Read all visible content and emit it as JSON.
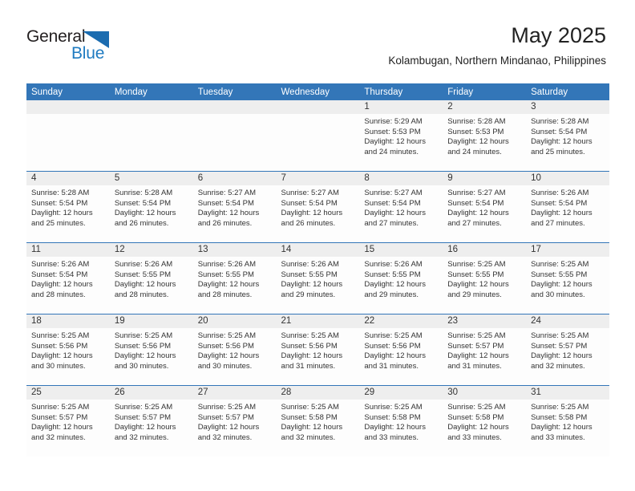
{
  "logo": {
    "line1": "General",
    "line2": "Blue",
    "triangle_color": "#1b6cb0",
    "blue_text_color": "#1f7bc1"
  },
  "header": {
    "month_title": "May 2025",
    "location": "Kolambugan, Northern Mindanao, Philippines"
  },
  "theme": {
    "header_bg": "#3376b8",
    "header_text": "#ffffff",
    "date_band_bg": "#eeeeee",
    "cell_bg": "#fdfdfd",
    "row_border": "#3376b8"
  },
  "calendar": {
    "weekday_headers": [
      "Sunday",
      "Monday",
      "Tuesday",
      "Wednesday",
      "Thursday",
      "Friday",
      "Saturday"
    ],
    "weeks": [
      [
        {
          "date": "",
          "sunrise": "",
          "sunset": "",
          "daylight_line1": "",
          "daylight_line2": ""
        },
        {
          "date": "",
          "sunrise": "",
          "sunset": "",
          "daylight_line1": "",
          "daylight_line2": ""
        },
        {
          "date": "",
          "sunrise": "",
          "sunset": "",
          "daylight_line1": "",
          "daylight_line2": ""
        },
        {
          "date": "",
          "sunrise": "",
          "sunset": "",
          "daylight_line1": "",
          "daylight_line2": ""
        },
        {
          "date": "1",
          "sunrise": "Sunrise: 5:29 AM",
          "sunset": "Sunset: 5:53 PM",
          "daylight_line1": "Daylight: 12 hours",
          "daylight_line2": "and 24 minutes."
        },
        {
          "date": "2",
          "sunrise": "Sunrise: 5:28 AM",
          "sunset": "Sunset: 5:53 PM",
          "daylight_line1": "Daylight: 12 hours",
          "daylight_line2": "and 24 minutes."
        },
        {
          "date": "3",
          "sunrise": "Sunrise: 5:28 AM",
          "sunset": "Sunset: 5:54 PM",
          "daylight_line1": "Daylight: 12 hours",
          "daylight_line2": "and 25 minutes."
        }
      ],
      [
        {
          "date": "4",
          "sunrise": "Sunrise: 5:28 AM",
          "sunset": "Sunset: 5:54 PM",
          "daylight_line1": "Daylight: 12 hours",
          "daylight_line2": "and 25 minutes."
        },
        {
          "date": "5",
          "sunrise": "Sunrise: 5:28 AM",
          "sunset": "Sunset: 5:54 PM",
          "daylight_line1": "Daylight: 12 hours",
          "daylight_line2": "and 26 minutes."
        },
        {
          "date": "6",
          "sunrise": "Sunrise: 5:27 AM",
          "sunset": "Sunset: 5:54 PM",
          "daylight_line1": "Daylight: 12 hours",
          "daylight_line2": "and 26 minutes."
        },
        {
          "date": "7",
          "sunrise": "Sunrise: 5:27 AM",
          "sunset": "Sunset: 5:54 PM",
          "daylight_line1": "Daylight: 12 hours",
          "daylight_line2": "and 26 minutes."
        },
        {
          "date": "8",
          "sunrise": "Sunrise: 5:27 AM",
          "sunset": "Sunset: 5:54 PM",
          "daylight_line1": "Daylight: 12 hours",
          "daylight_line2": "and 27 minutes."
        },
        {
          "date": "9",
          "sunrise": "Sunrise: 5:27 AM",
          "sunset": "Sunset: 5:54 PM",
          "daylight_line1": "Daylight: 12 hours",
          "daylight_line2": "and 27 minutes."
        },
        {
          "date": "10",
          "sunrise": "Sunrise: 5:26 AM",
          "sunset": "Sunset: 5:54 PM",
          "daylight_line1": "Daylight: 12 hours",
          "daylight_line2": "and 27 minutes."
        }
      ],
      [
        {
          "date": "11",
          "sunrise": "Sunrise: 5:26 AM",
          "sunset": "Sunset: 5:54 PM",
          "daylight_line1": "Daylight: 12 hours",
          "daylight_line2": "and 28 minutes."
        },
        {
          "date": "12",
          "sunrise": "Sunrise: 5:26 AM",
          "sunset": "Sunset: 5:55 PM",
          "daylight_line1": "Daylight: 12 hours",
          "daylight_line2": "and 28 minutes."
        },
        {
          "date": "13",
          "sunrise": "Sunrise: 5:26 AM",
          "sunset": "Sunset: 5:55 PM",
          "daylight_line1": "Daylight: 12 hours",
          "daylight_line2": "and 28 minutes."
        },
        {
          "date": "14",
          "sunrise": "Sunrise: 5:26 AM",
          "sunset": "Sunset: 5:55 PM",
          "daylight_line1": "Daylight: 12 hours",
          "daylight_line2": "and 29 minutes."
        },
        {
          "date": "15",
          "sunrise": "Sunrise: 5:26 AM",
          "sunset": "Sunset: 5:55 PM",
          "daylight_line1": "Daylight: 12 hours",
          "daylight_line2": "and 29 minutes."
        },
        {
          "date": "16",
          "sunrise": "Sunrise: 5:25 AM",
          "sunset": "Sunset: 5:55 PM",
          "daylight_line1": "Daylight: 12 hours",
          "daylight_line2": "and 29 minutes."
        },
        {
          "date": "17",
          "sunrise": "Sunrise: 5:25 AM",
          "sunset": "Sunset: 5:55 PM",
          "daylight_line1": "Daylight: 12 hours",
          "daylight_line2": "and 30 minutes."
        }
      ],
      [
        {
          "date": "18",
          "sunrise": "Sunrise: 5:25 AM",
          "sunset": "Sunset: 5:56 PM",
          "daylight_line1": "Daylight: 12 hours",
          "daylight_line2": "and 30 minutes."
        },
        {
          "date": "19",
          "sunrise": "Sunrise: 5:25 AM",
          "sunset": "Sunset: 5:56 PM",
          "daylight_line1": "Daylight: 12 hours",
          "daylight_line2": "and 30 minutes."
        },
        {
          "date": "20",
          "sunrise": "Sunrise: 5:25 AM",
          "sunset": "Sunset: 5:56 PM",
          "daylight_line1": "Daylight: 12 hours",
          "daylight_line2": "and 30 minutes."
        },
        {
          "date": "21",
          "sunrise": "Sunrise: 5:25 AM",
          "sunset": "Sunset: 5:56 PM",
          "daylight_line1": "Daylight: 12 hours",
          "daylight_line2": "and 31 minutes."
        },
        {
          "date": "22",
          "sunrise": "Sunrise: 5:25 AM",
          "sunset": "Sunset: 5:56 PM",
          "daylight_line1": "Daylight: 12 hours",
          "daylight_line2": "and 31 minutes."
        },
        {
          "date": "23",
          "sunrise": "Sunrise: 5:25 AM",
          "sunset": "Sunset: 5:57 PM",
          "daylight_line1": "Daylight: 12 hours",
          "daylight_line2": "and 31 minutes."
        },
        {
          "date": "24",
          "sunrise": "Sunrise: 5:25 AM",
          "sunset": "Sunset: 5:57 PM",
          "daylight_line1": "Daylight: 12 hours",
          "daylight_line2": "and 32 minutes."
        }
      ],
      [
        {
          "date": "25",
          "sunrise": "Sunrise: 5:25 AM",
          "sunset": "Sunset: 5:57 PM",
          "daylight_line1": "Daylight: 12 hours",
          "daylight_line2": "and 32 minutes."
        },
        {
          "date": "26",
          "sunrise": "Sunrise: 5:25 AM",
          "sunset": "Sunset: 5:57 PM",
          "daylight_line1": "Daylight: 12 hours",
          "daylight_line2": "and 32 minutes."
        },
        {
          "date": "27",
          "sunrise": "Sunrise: 5:25 AM",
          "sunset": "Sunset: 5:57 PM",
          "daylight_line1": "Daylight: 12 hours",
          "daylight_line2": "and 32 minutes."
        },
        {
          "date": "28",
          "sunrise": "Sunrise: 5:25 AM",
          "sunset": "Sunset: 5:58 PM",
          "daylight_line1": "Daylight: 12 hours",
          "daylight_line2": "and 32 minutes."
        },
        {
          "date": "29",
          "sunrise": "Sunrise: 5:25 AM",
          "sunset": "Sunset: 5:58 PM",
          "daylight_line1": "Daylight: 12 hours",
          "daylight_line2": "and 33 minutes."
        },
        {
          "date": "30",
          "sunrise": "Sunrise: 5:25 AM",
          "sunset": "Sunset: 5:58 PM",
          "daylight_line1": "Daylight: 12 hours",
          "daylight_line2": "and 33 minutes."
        },
        {
          "date": "31",
          "sunrise": "Sunrise: 5:25 AM",
          "sunset": "Sunset: 5:58 PM",
          "daylight_line1": "Daylight: 12 hours",
          "daylight_line2": "and 33 minutes."
        }
      ]
    ]
  }
}
